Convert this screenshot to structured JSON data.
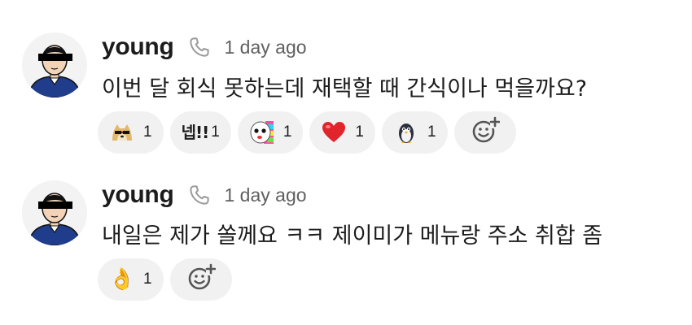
{
  "messages": [
    {
      "sender": "young",
      "timestamp": "1 day ago",
      "text": "이번 달 회식 못하는데 재택할 때 간식이나 먹을까요?",
      "reactions": [
        {
          "emoji": "doge-sunglasses",
          "count": "1"
        },
        {
          "emoji": "넵!!",
          "count": "1"
        },
        {
          "emoji": "party-face",
          "count": "1"
        },
        {
          "emoji": "❤️",
          "count": "1"
        },
        {
          "emoji": "penguin",
          "count": "1"
        }
      ]
    },
    {
      "sender": "young",
      "timestamp": "1 day ago",
      "text": "내일은 제가 쏠께요 ㅋㅋ 제이미가 메뉴랑 주소 취합 좀",
      "reactions": [
        {
          "emoji": "👌",
          "count": "1"
        }
      ]
    }
  ]
}
